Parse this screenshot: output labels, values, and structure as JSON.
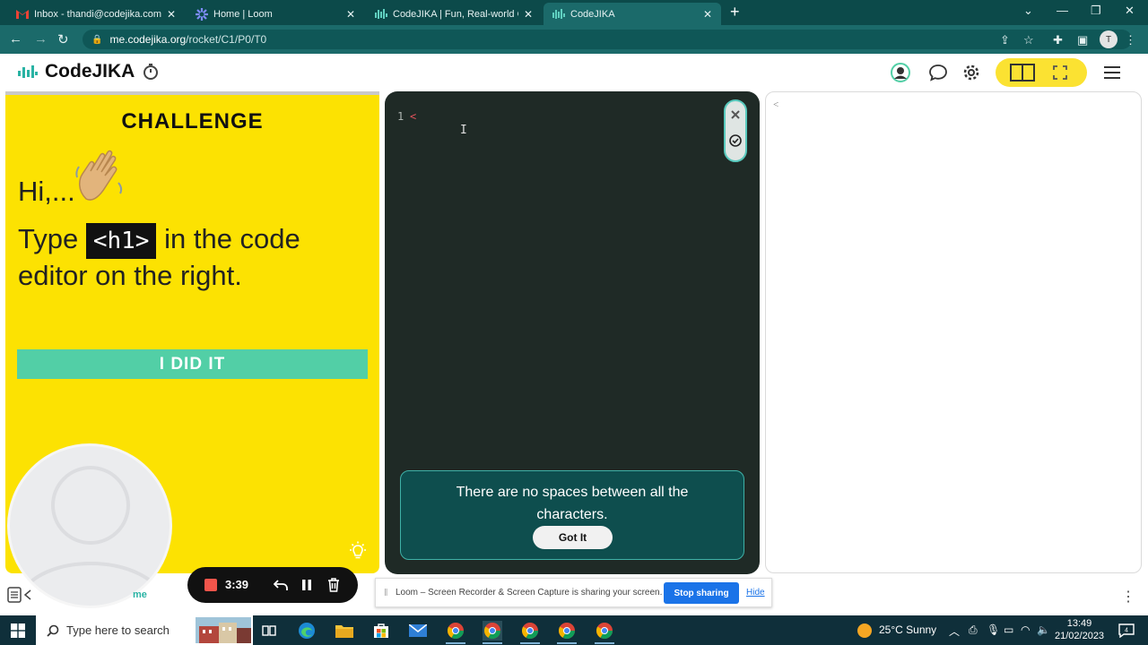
{
  "browser": {
    "tabs": [
      {
        "label": "Inbox - thandi@codejika.com - G",
        "icon": "gmail-icon"
      },
      {
        "label": "Home | Loom",
        "icon": "loom-icon"
      },
      {
        "label": "CodeJIKA | Fun, Real-world Codin",
        "icon": "codejika-icon"
      },
      {
        "label": "CodeJIKA",
        "icon": "codejika-icon"
      }
    ],
    "url_host": "me.codejika.org",
    "url_path": "/rocket/C1/P0/T0",
    "profile_initial": "T"
  },
  "app": {
    "brand": "CodeJIKA"
  },
  "challenge": {
    "title": "CHALLENGE",
    "greeting": "Hi,...",
    "instruction_pre": "Type",
    "instruction_code": "<h1>",
    "instruction_post": "in the code editor on the right.",
    "button": "I DID IT"
  },
  "editor": {
    "line_number": "1",
    "line_content": "<",
    "cursor": "I",
    "hint_text": "There are no spaces between all the characters.",
    "hint_button": "Got It"
  },
  "preview": {
    "content": "<"
  },
  "loom": {
    "timer": "3:39",
    "fragment": "me",
    "share_message": "Loom – Screen Recorder & Screen Capture is sharing your screen.",
    "stop_sharing": "Stop sharing",
    "hide": "Hide"
  },
  "taskbar": {
    "search_placeholder": "Type here to search",
    "weather": "25°C  Sunny",
    "time": "13:49",
    "date": "21/02/2023",
    "notifications": "4"
  },
  "colors": {
    "brand_yellow": "#fce202",
    "accent_teal": "#52cfa6",
    "editor_bg": "#1f2a26",
    "hint_bg": "#0e4e4e",
    "chrome_teal": "#1b6a6a"
  }
}
